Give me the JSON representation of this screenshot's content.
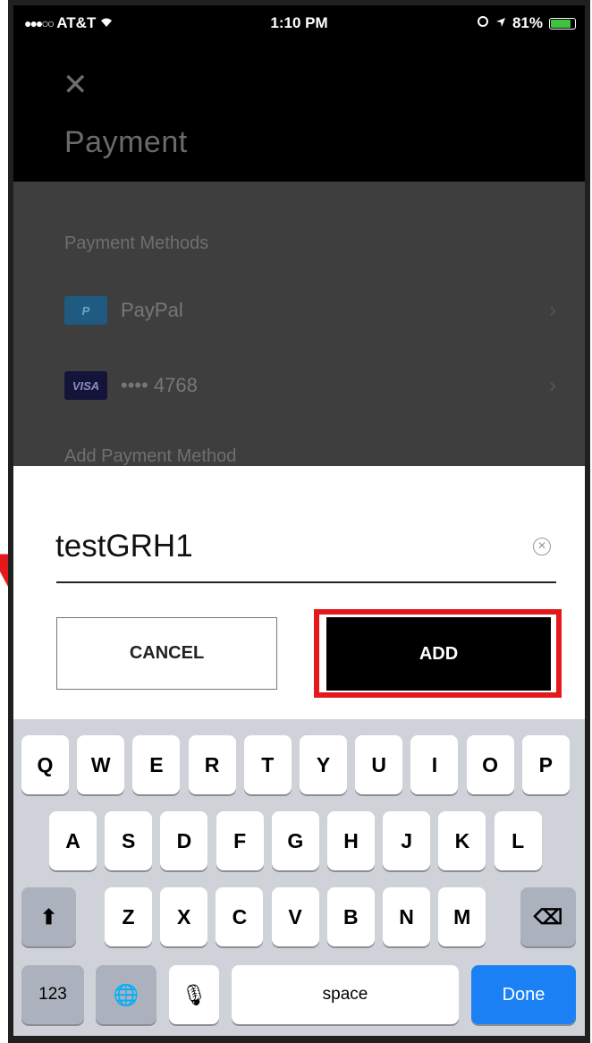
{
  "status_bar": {
    "carrier": "AT&T",
    "time": "1:10 PM",
    "battery": "81%"
  },
  "header": {
    "close_glyph": "✕",
    "title": "Payment"
  },
  "payment_methods": {
    "section_title": "Payment Methods",
    "items": [
      {
        "icon": "paypal-icon",
        "icon_text": "P",
        "label": "PayPal"
      },
      {
        "icon": "visa-icon",
        "icon_text": "VISA",
        "label": "•••• 4768"
      }
    ],
    "add_label": "Add Payment Method"
  },
  "dialog": {
    "input_value": "testGRH1",
    "clear_glyph": "✕",
    "cancel_label": "CANCEL",
    "add_label": "ADD",
    "highlight_color": "#e3191b"
  },
  "keyboard": {
    "row1": [
      "Q",
      "W",
      "E",
      "R",
      "T",
      "Y",
      "U",
      "I",
      "O",
      "P"
    ],
    "row2": [
      "A",
      "S",
      "D",
      "F",
      "G",
      "H",
      "J",
      "K",
      "L"
    ],
    "row3": [
      "Z",
      "X",
      "C",
      "V",
      "B",
      "N",
      "M"
    ],
    "shift_glyph": "⬆",
    "backspace_glyph": "⌫",
    "numbers_label": "123",
    "globe_glyph": "🌐",
    "mic_glyph": "🎙",
    "space_label": "space",
    "done_label": "Done",
    "done_color": "#1a80f4"
  }
}
